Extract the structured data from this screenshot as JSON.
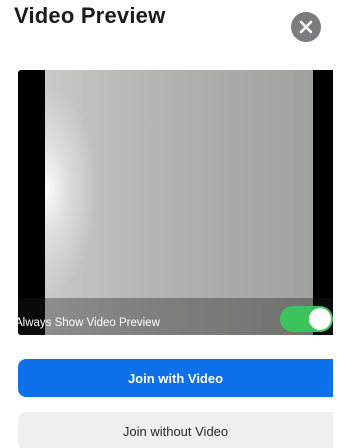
{
  "header": {
    "title": "Video Preview",
    "close_icon": "close-icon"
  },
  "preview": {
    "always_show_label": "Always Show Video Preview",
    "always_show_enabled": true
  },
  "buttons": {
    "join_with_video": "Join with Video",
    "join_without_video": "Join without Video"
  },
  "colors": {
    "primary": "#0e71eb",
    "toggle_on": "#3dc35b",
    "close_bg": "#7b7b80",
    "secondary_bg": "#eeeff2"
  }
}
